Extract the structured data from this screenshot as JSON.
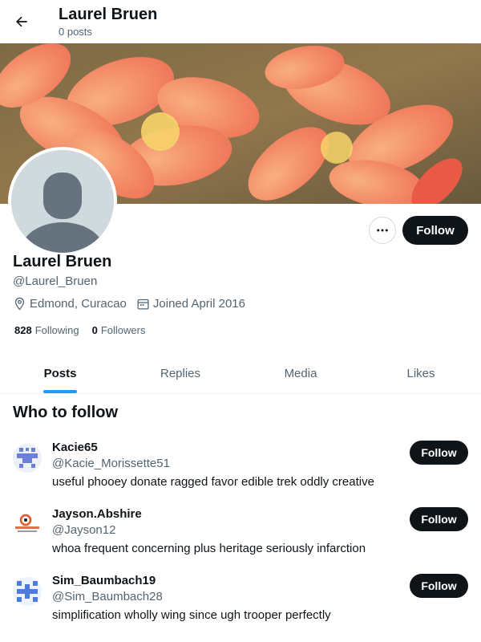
{
  "header": {
    "title": "Laurel Bruen",
    "subtitle": "0 posts"
  },
  "profile": {
    "name": "Laurel Bruen",
    "handle": "@Laurel_Bruen",
    "location": "Edmond, Curacao",
    "joined": "Joined April 2016",
    "following_count": "828",
    "following_label": "Following",
    "followers_count": "0",
    "followers_label": "Followers",
    "follow_label": "Follow"
  },
  "tabs": [
    {
      "label": "Posts"
    },
    {
      "label": "Replies"
    },
    {
      "label": "Media"
    },
    {
      "label": "Likes"
    }
  ],
  "who_to_follow": {
    "title": "Who to follow",
    "items": [
      {
        "name": "Kacie65",
        "handle": "@Kacie_Morissette51",
        "bio": "useful phooey donate ragged favor edible trek oddly creative",
        "follow_label": "Follow"
      },
      {
        "name": "Jayson.Abshire",
        "handle": "@Jayson12",
        "bio": "whoa frequent concerning plus heritage seriously infarction",
        "follow_label": "Follow"
      },
      {
        "name": "Sim_Baumbach19",
        "handle": "@Sim_Baumbach28",
        "bio": "simplification wholly wing since ugh trooper perfectly",
        "follow_label": "Follow"
      }
    ]
  },
  "colors": {
    "accent": "#1d9bf0",
    "button": "#0f1419",
    "muted": "#536471"
  }
}
